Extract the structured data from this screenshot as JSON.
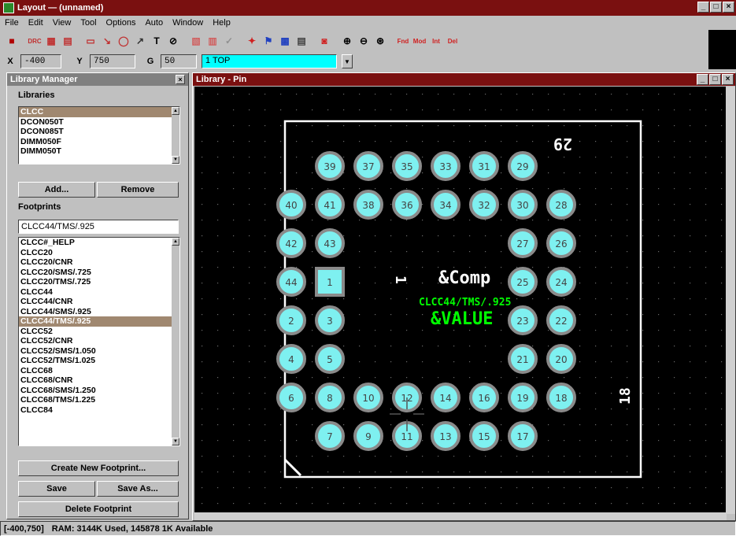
{
  "window": {
    "title": "Layout — (unnamed)"
  },
  "menu": [
    "File",
    "Edit",
    "View",
    "Tool",
    "Options",
    "Auto",
    "Window",
    "Help"
  ],
  "toolbar_icons": [
    "open-icon",
    "drc-icon",
    "bom-icon",
    "netlist-icon",
    "pad-icon",
    "route-icon",
    "obstacle-icon",
    "text-icon",
    "component-icon",
    "error-icon",
    "connect-icon",
    "pin-icon",
    "color-icon",
    "library-icon",
    "spreadsheet-icon",
    "report-icon",
    "zoom-in-icon",
    "zoom-out-icon",
    "zoom-all-icon",
    "find-icon",
    "mod-icon",
    "net-icon",
    "drc-toggle-icon"
  ],
  "coords": {
    "x_label": "X",
    "x_value": "-400",
    "y_label": "Y",
    "y_value": "750",
    "g_label": "G",
    "g_value": "50",
    "layer": "1 TOP"
  },
  "library_manager": {
    "title": "Library Manager",
    "libraries_label": "Libraries",
    "libraries": [
      "CLCC",
      "DCON050T",
      "DCON085T",
      "DIMM050F",
      "DIMM050T"
    ],
    "selected_library": 0,
    "add_label": "Add...",
    "remove_label": "Remove",
    "footprints_label": "Footprints",
    "footprint_search": "CLCC44/TMS/.925",
    "footprints": [
      "CLCC#_HELP",
      "CLCC20",
      "CLCC20/CNR",
      "CLCC20/SMS/.725",
      "CLCC20/TMS/.725",
      "CLCC44",
      "CLCC44/CNR",
      "CLCC44/SMS/.925",
      "CLCC44/TMS/.925",
      "CLCC52",
      "CLCC52/CNR",
      "CLCC52/SMS/1.050",
      "CLCC52/TMS/1.025",
      "CLCC68",
      "CLCC68/CNR",
      "CLCC68/SMS/1.250",
      "CLCC68/TMS/1.225",
      "CLCC84"
    ],
    "selected_footprint": 8,
    "create_label": "Create New Footprint...",
    "save_label": "Save",
    "save_as_label": "Save As...",
    "delete_label": "Delete Footprint"
  },
  "pcb_window": {
    "title": "Library - Pin",
    "label_29": "29",
    "label_1": "1",
    "label_18": "18",
    "comp_text": "&Comp",
    "name_text": "CLCC44/TMS/.925",
    "value_text": "&VALUE",
    "pad_color": "#7ef0f0",
    "pad_ring_color": "#8a8a8a",
    "outline_color": "#ffffff",
    "green_text_color": "#00ff00",
    "pads": [
      "39",
      "37",
      "35",
      "33",
      "31",
      "29",
      "40",
      "41",
      "38",
      "36",
      "34",
      "32",
      "30",
      "28",
      "42",
      "43",
      "27",
      "26",
      "44",
      "1",
      "25",
      "24",
      "2",
      "3",
      "23",
      "22",
      "4",
      "5",
      "21",
      "20",
      "6",
      "8",
      "10",
      "12",
      "14",
      "16",
      "19",
      "18",
      "7",
      "9",
      "11",
      "13",
      "15",
      "17"
    ]
  },
  "status": {
    "coords": "[-400,750]",
    "ram": "RAM: 3144K Used, 145878 1K Available"
  }
}
